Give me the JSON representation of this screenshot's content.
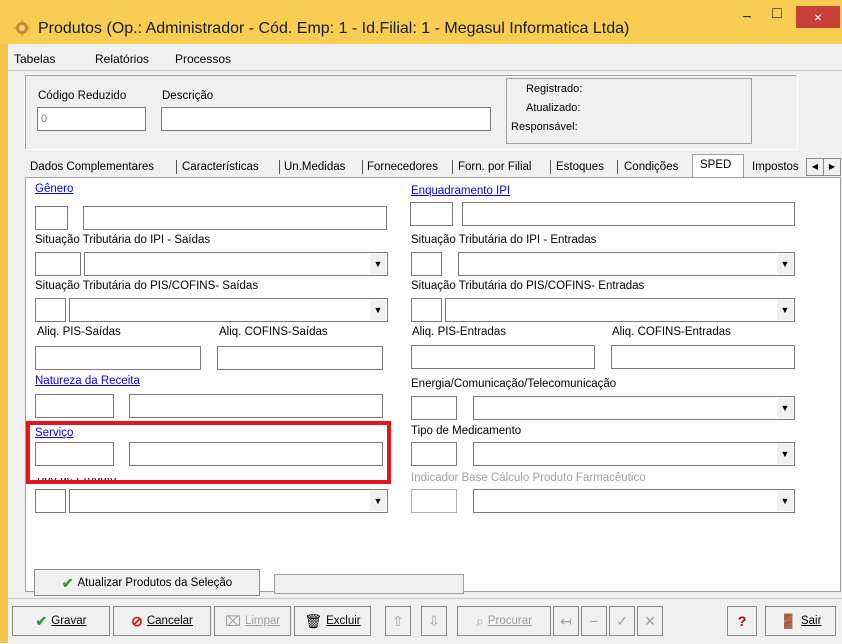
{
  "window": {
    "title": "Produtos (Op.: Administrador - Cód. Emp: 1 - Id.Filial: 1 - Megasul Informatica Ltda)",
    "minimize": "−",
    "maximize": "□",
    "close": "×"
  },
  "menu": [
    "Tabelas",
    "Relatórios",
    "Processos"
  ],
  "header": {
    "codigo_label": "Código Reduzido",
    "codigo_value": "0",
    "descricao_label": "Descrição",
    "descricao_value": "",
    "registrado": "Registrado:",
    "atualizado": "Atualizado:",
    "responsavel": "Responsável:"
  },
  "tabs": [
    "Dados Complementares",
    "Características",
    "Un.Medidas",
    "Fornecedores",
    "Forn. por Filial",
    "Estoques",
    "Condições",
    "SPED",
    "Impostos"
  ],
  "active_tab": "SPED",
  "tab_scroll": {
    "left": "◀",
    "right": "▶"
  },
  "sped": {
    "genero": "Gênero",
    "enquadramento_ipi": "Enquadramento IPI",
    "cst_ipi_saidas": "Situação Tributária do IPI - Saídas",
    "cst_ipi_entradas": "Situação Tributária do IPI - Entradas",
    "cst_pis_saidas": "Situação Tributária do PIS/COFINS- Saídas",
    "cst_pis_entradas": "Situação Tributária do PIS/COFINS- Entradas",
    "aliq_pis_saidas": "Aliq. PIS-Saídas",
    "aliq_cofins_saidas": "Aliq. COFINS-Saídas",
    "aliq_pis_entradas": "Aliq. PIS-Entradas",
    "aliq_cofins_entradas": "Aliq. COFINS-Entradas",
    "natureza_receita": "Natureza da Receita",
    "energia": "Energia/Comunicação/Telecomunicação",
    "servico": "Serviço",
    "tipo_medicamento": "Tipo de Medicamento",
    "tipo_produto": "Tipo de Produto",
    "indicador_base": "Indicador Base Cálculo Produto Farmacêutico"
  },
  "atualizar_button": "Atualizar Produtos da Seleção",
  "toolbar": {
    "gravar": "Gravar",
    "cancelar": "Cancelar",
    "limpar": "Limpar",
    "excluir": "Excluir",
    "procurar": "Procurar",
    "ajuda": "?",
    "sair": "Sair"
  },
  "colors": {
    "title_bar": "#f7cd52",
    "close_button": "#c7413a",
    "link": "#0000ff",
    "highlight_box": "#e8141c"
  }
}
